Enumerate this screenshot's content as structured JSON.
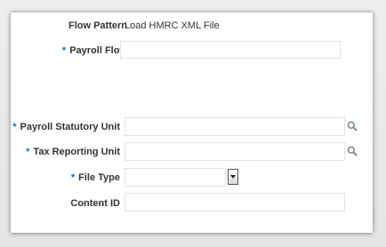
{
  "form": {
    "flow_pattern_label": "Flow Pattern",
    "flow_pattern_value": "Load HMRC XML File",
    "required_marker": "*",
    "payroll_flow_label": "Payroll Flow",
    "payroll_flow_value": "",
    "psu_label": "Payroll Statutory Unit",
    "psu_value": "",
    "tru_label": "Tax Reporting Unit",
    "tru_value": "",
    "file_type_label": "File Type",
    "file_type_value": "",
    "content_id_label": "Content ID",
    "content_id_value": ""
  },
  "icons": {
    "search": "search-icon",
    "dropdown": "chevron-down-icon"
  },
  "colors": {
    "required": "#0572ce",
    "label": "#333333",
    "field_border": "#dfe4e7"
  }
}
